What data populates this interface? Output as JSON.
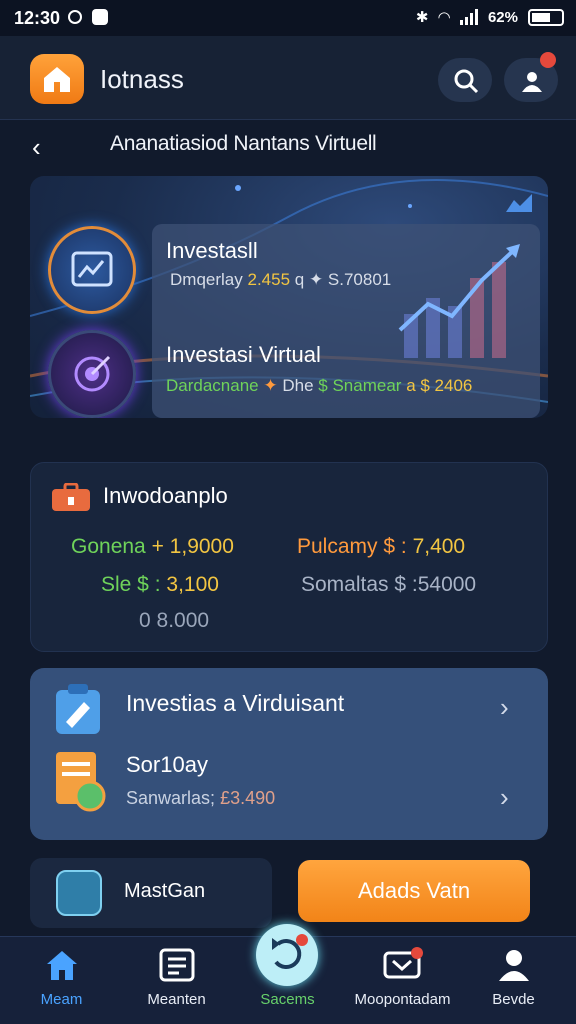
{
  "status_bar": {
    "time": "12:30",
    "battery_text": "62%"
  },
  "header": {
    "app_title": "Iotnass"
  },
  "subheader": {
    "back_glyph": "‹",
    "title": "Ananatiasiod Nantans Virtuell"
  },
  "hero": {
    "card1": {
      "title": "Investasll",
      "line_prefix": "Dmqerlay",
      "line_value": "2.455",
      "line_suffix": "q ✦ S.70801"
    },
    "card2": {
      "title": "Investasi Virtual",
      "line_prefix": "Dardacnane",
      "line_mid": "Dhe",
      "line_dollar": "$",
      "line_label": "Snamear",
      "line_value": "a $ 2406"
    }
  },
  "summary": {
    "title": "Inwodoanplo",
    "row1_left_label": "Gonena",
    "row1_left_value": "+ 1,9000",
    "row1_right_label": "Pulcamy $ :",
    "row1_right_value": "7,400",
    "row2_left_label": "Sle $ :",
    "row2_left_value": "3,100",
    "row2_right": "Somaltas $ :54000",
    "row3": "0 8.000"
  },
  "invest": {
    "item1_title": "Investias a Virduisant",
    "item2_title": "Sor10ay",
    "item2_label": "Sanwarlas;",
    "item2_value": "£3.490"
  },
  "actions": {
    "secondary_label": "MastGan",
    "primary_label": "Adads Vatn"
  },
  "tabs": [
    {
      "label": "Meam",
      "icon": "home-icon"
    },
    {
      "label": "Meanten",
      "icon": "list-icon"
    },
    {
      "label": "Sacems",
      "icon": "refresh-icon"
    },
    {
      "label": "Moopontadam",
      "icon": "message-icon"
    },
    {
      "label": "Bevde",
      "icon": "user-icon"
    }
  ],
  "colors": {
    "accent_orange": "#f28418",
    "active_tab": "#4aa3ff",
    "card_blue": "#35507a",
    "green": "#6fd35a",
    "yellow": "#f2c542"
  }
}
